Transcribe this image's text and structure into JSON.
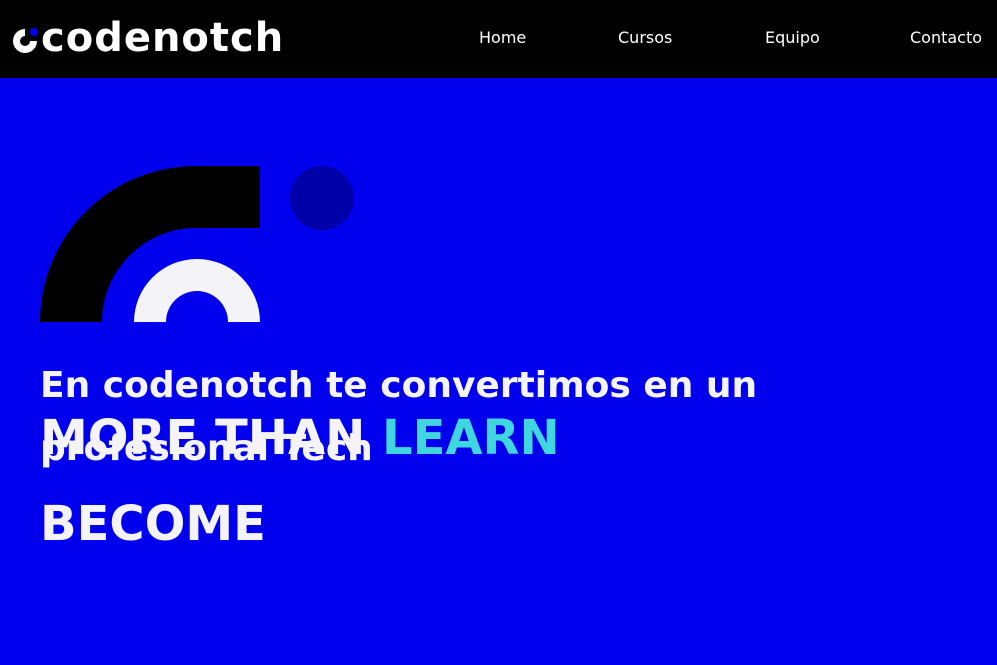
{
  "header": {
    "logo": {
      "text": "codenotch",
      "icon": "codenotch-logo-mark"
    },
    "nav": [
      {
        "label": "Home"
      },
      {
        "label": "Cursos"
      },
      {
        "label": "Equipo"
      },
      {
        "label": "Contacto"
      }
    ]
  },
  "hero": {
    "graphic": "codenotch-arc-illustration",
    "headline": "En codenotch te convertimos en un profesional Tech",
    "tagline_line1_prefix": "MORE THAN ",
    "tagline_line1_accent": "LEARN",
    "tagline_line2": "BECOME"
  },
  "colors": {
    "header_bg": "#000000",
    "hero_bg": "#0000ee",
    "text": "#f3f3f8",
    "accent": "#3fd6e0",
    "dot": "#0000a8"
  }
}
